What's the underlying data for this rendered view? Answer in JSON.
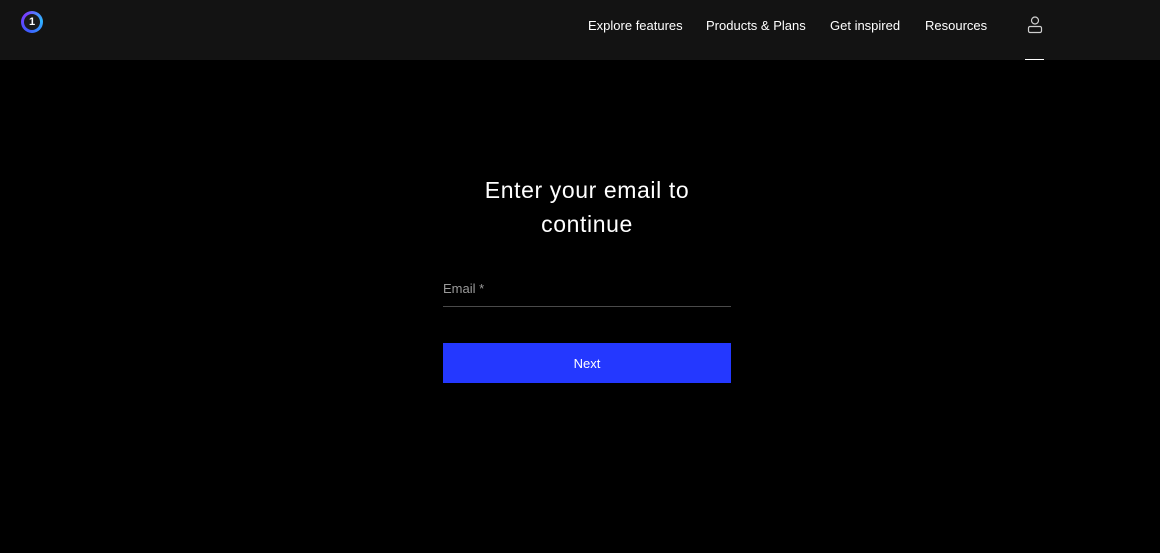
{
  "header": {
    "logo_text": "1",
    "nav": [
      {
        "label": "Explore features"
      },
      {
        "label": "Products & Plans"
      },
      {
        "label": "Get inspired"
      },
      {
        "label": "Resources"
      }
    ],
    "user_icon": "user-icon"
  },
  "form": {
    "heading_line1": "Enter your email to",
    "heading_line2": "continue",
    "email_label": "Email *",
    "email_value": "",
    "next_label": "Next"
  },
  "colors": {
    "background": "#000000",
    "header_background": "#131313",
    "accent": "#2438ff"
  }
}
